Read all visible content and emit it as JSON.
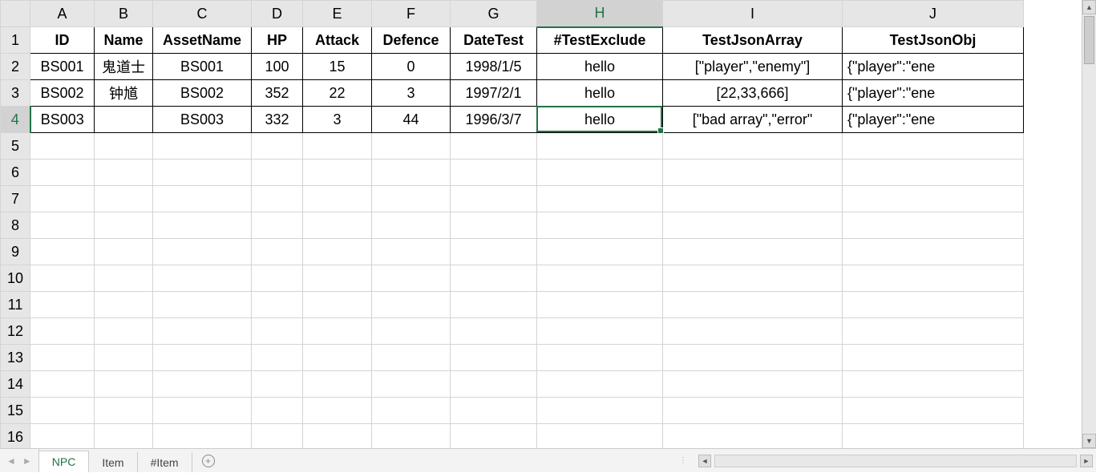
{
  "columns": [
    "A",
    "B",
    "C",
    "D",
    "E",
    "F",
    "G",
    "H",
    "I",
    "J"
  ],
  "rows": [
    "1",
    "2",
    "3",
    "4",
    "5",
    "6",
    "7",
    "8",
    "9",
    "10",
    "11",
    "12",
    "13",
    "14",
    "15",
    "16"
  ],
  "active_column": "H",
  "active_row": "4",
  "selected_cell": "H4",
  "headers": {
    "A": "ID",
    "B": "Name",
    "C": "AssetName",
    "D": "HP",
    "E": "Attack",
    "F": "Defence",
    "G": "DateTest",
    "H": "#TestExclude",
    "I": "TestJsonArray",
    "J": "TestJsonObj"
  },
  "data": [
    {
      "A": "BS001",
      "B": "鬼道士",
      "C": "BS001",
      "D": "100",
      "E": "15",
      "F": "0",
      "G": "1998/1/5",
      "H": "hello",
      "I": "[\"player\",\"enemy\"]",
      "J": "{\"player\":\"ene"
    },
    {
      "A": "BS002",
      "B": "钟馗",
      "C": "BS002",
      "D": "352",
      "E": "22",
      "F": "3",
      "G": "1997/2/1",
      "H": "hello",
      "I": "[22,33,666]",
      "J": "{\"player\":\"ene"
    },
    {
      "A": "BS003",
      "B": "",
      "C": "BS003",
      "D": "332",
      "E": "3",
      "F": "44",
      "G": "1996/3/7",
      "H": "hello",
      "I": "[\"bad array\",\"error\"",
      "J": "{\"player\":\"ene"
    }
  ],
  "tabs": [
    {
      "name": "NPC",
      "active": true
    },
    {
      "name": "Item",
      "active": false
    },
    {
      "name": "#Item",
      "active": false
    }
  ]
}
